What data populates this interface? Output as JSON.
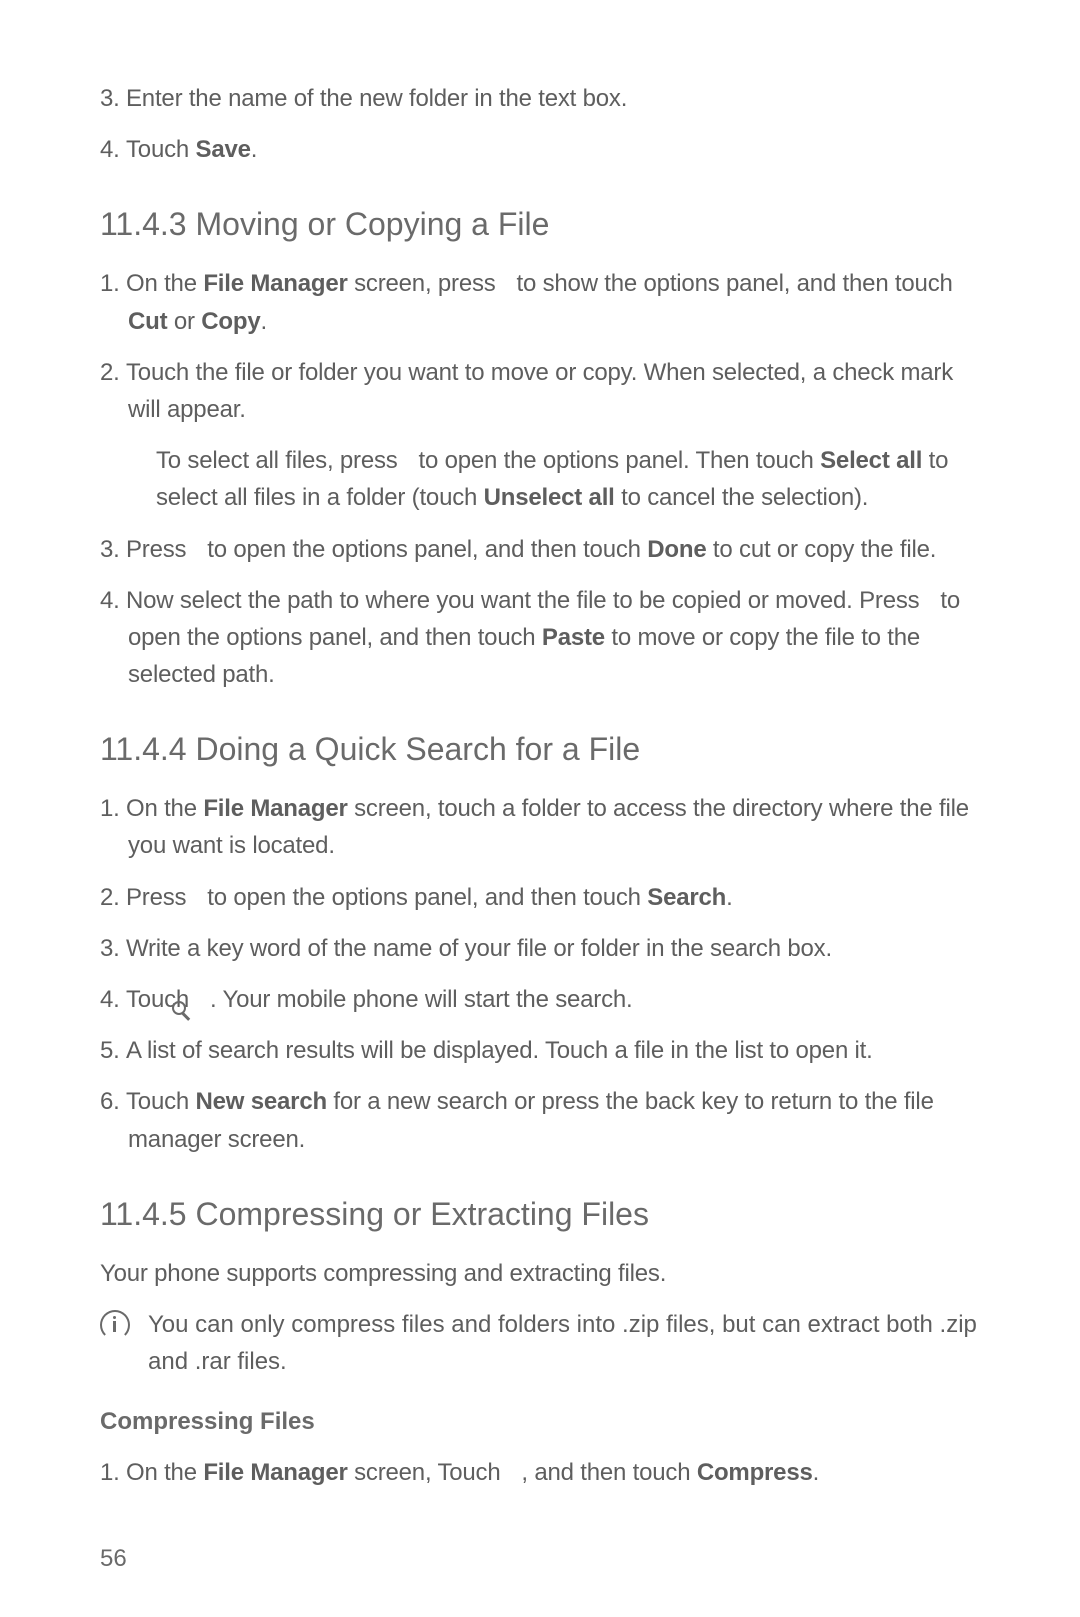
{
  "intro_items": [
    {
      "num": "3.",
      "parts": [
        {
          "t": "Enter the name of the new folder in the text box."
        }
      ]
    },
    {
      "num": "4.",
      "parts": [
        {
          "t": "Touch "
        },
        {
          "t": "Save",
          "b": true
        },
        {
          "t": "."
        }
      ]
    }
  ],
  "section_1143": {
    "title": "11.4.3  Moving or Copying a File",
    "items": [
      {
        "num": "1.",
        "parts": [
          {
            "t": "On the "
          },
          {
            "t": "File Manager",
            "b": true
          },
          {
            "t": " screen, press  "
          },
          {
            "icon": "menu"
          },
          {
            "t": "  to show the options panel, and then touch "
          },
          {
            "t": "Cut",
            "b": true
          },
          {
            "t": " or "
          },
          {
            "t": "Copy",
            "b": true
          },
          {
            "t": "."
          }
        ]
      },
      {
        "num": "2.",
        "parts": [
          {
            "t": "Touch the file or folder you want to move or copy. When selected, a check mark will appear."
          }
        ],
        "sub": {
          "parts": [
            {
              "t": "To select all files, press  "
            },
            {
              "icon": "menu"
            },
            {
              "t": "  to open the options panel. Then touch "
            },
            {
              "t": "Select all",
              "b": true
            },
            {
              "t": " to select all files in a folder (touch "
            },
            {
              "t": "Unselect all",
              "b": true
            },
            {
              "t": " to cancel the selection)."
            }
          ]
        }
      },
      {
        "num": "3.",
        "parts": [
          {
            "t": "Press  "
          },
          {
            "icon": "menu"
          },
          {
            "t": "  to open the options panel, and then touch "
          },
          {
            "t": "Done",
            "b": true
          },
          {
            "t": " to cut or copy the file."
          }
        ]
      },
      {
        "num": "4.",
        "parts": [
          {
            "t": "Now select the path to where you want the file to be copied or moved. Press  "
          },
          {
            "icon": "menu"
          },
          {
            "t": "  to open the options panel, and then touch "
          },
          {
            "t": "Paste",
            "b": true
          },
          {
            "t": " to move or copy the file to the selected path."
          }
        ]
      }
    ]
  },
  "section_1144": {
    "title": "11.4.4  Doing a Quick Search for a File",
    "items": [
      {
        "num": "1.",
        "parts": [
          {
            "t": "On the "
          },
          {
            "t": "File Manager",
            "b": true
          },
          {
            "t": " screen, touch a folder to access the directory where the file you want is located."
          }
        ]
      },
      {
        "num": "2.",
        "parts": [
          {
            "t": "Press  "
          },
          {
            "icon": "menu"
          },
          {
            "t": "  to open the options panel, and then touch "
          },
          {
            "t": "Search",
            "b": true
          },
          {
            "t": "."
          }
        ]
      },
      {
        "num": "3.",
        "parts": [
          {
            "t": "Write a key word of the name of your file or folder in the search box."
          }
        ]
      },
      {
        "num": "4.",
        "parts": [
          {
            "t": "Touch  "
          },
          {
            "icon": "search"
          },
          {
            "t": " . Your mobile phone will start the search."
          }
        ]
      },
      {
        "num": "5.",
        "parts": [
          {
            "t": "A list of search results will be displayed. Touch a file in the list to open it."
          }
        ]
      },
      {
        "num": "6.",
        "parts": [
          {
            "t": "Touch "
          },
          {
            "t": "New search",
            "b": true
          },
          {
            "t": " for a new search or press the back key to return to the file manager screen."
          }
        ]
      }
    ]
  },
  "section_1145": {
    "title": "11.4.5  Compressing or Extracting Files",
    "intro": "Your phone supports compressing and extracting files.",
    "note": "You can only compress files and folders into .zip files, but can extract both .zip and .rar files.",
    "subheading": "Compressing Files",
    "items": [
      {
        "num": "1.",
        "parts": [
          {
            "t": "On the "
          },
          {
            "t": "File Manager",
            "b": true
          },
          {
            "t": " screen, Touch  "
          },
          {
            "icon": "menu"
          },
          {
            "t": " , and then touch "
          },
          {
            "t": "Compress",
            "b": true
          },
          {
            "t": "."
          }
        ]
      }
    ]
  },
  "page_number": "56"
}
